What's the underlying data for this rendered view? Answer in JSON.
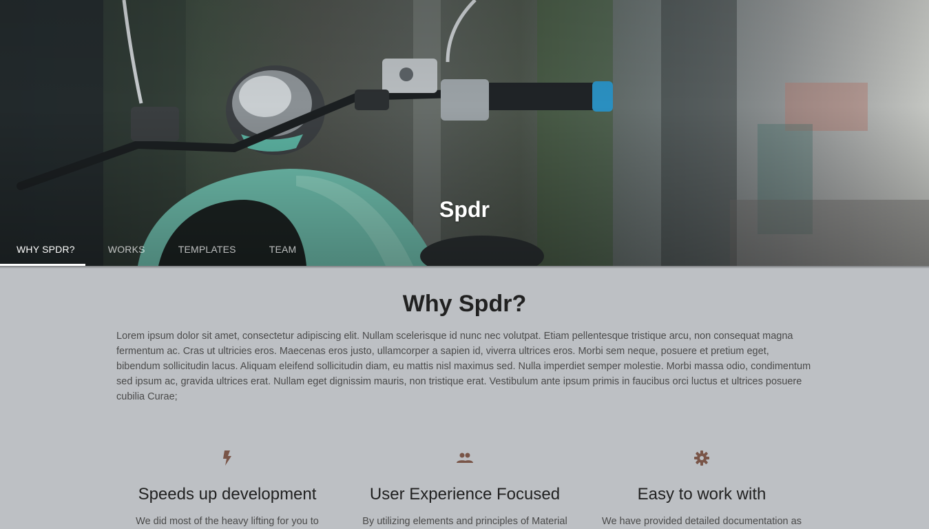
{
  "hero": {
    "title": "Spdr"
  },
  "tabs": [
    {
      "label": "Why Spdr?",
      "active": true
    },
    {
      "label": "Works",
      "active": false
    },
    {
      "label": "Templates",
      "active": false
    },
    {
      "label": "Team",
      "active": false
    }
  ],
  "section": {
    "title": "Why Spdr?",
    "body": "Lorem ipsum dolor sit amet, consectetur adipiscing elit. Nullam scelerisque id nunc nec volutpat. Etiam pellentesque tristique arcu, non consequat magna fermentum ac. Cras ut ultricies eros. Maecenas eros justo, ullamcorper a sapien id, viverra ultrices eros. Morbi sem neque, posuere et pretium eget, bibendum sollicitudin lacus. Aliquam eleifend sollicitudin diam, eu mattis nisl maximus sed. Nulla imperdiet semper molestie. Morbi massa odio, condimentum sed ipsum ac, gravida ultrices erat. Nullam eget dignissim mauris, non tristique erat. Vestibulum ante ipsum primis in faucibus orci luctus et ultrices posuere cubilia Curae;"
  },
  "features": [
    {
      "icon": "flash-icon",
      "title": "Speeds up development",
      "text": "We did most of the heavy lifting for you to"
    },
    {
      "icon": "group-icon",
      "title": "User Experience Focused",
      "text": "By utilizing elements and principles of Material"
    },
    {
      "icon": "settings-icon",
      "title": "Easy to work with",
      "text": "We have provided detailed documentation as"
    }
  ],
  "colors": {
    "accent": "#795548",
    "indicator": "#ffffff",
    "background": "#bdc0c4"
  }
}
